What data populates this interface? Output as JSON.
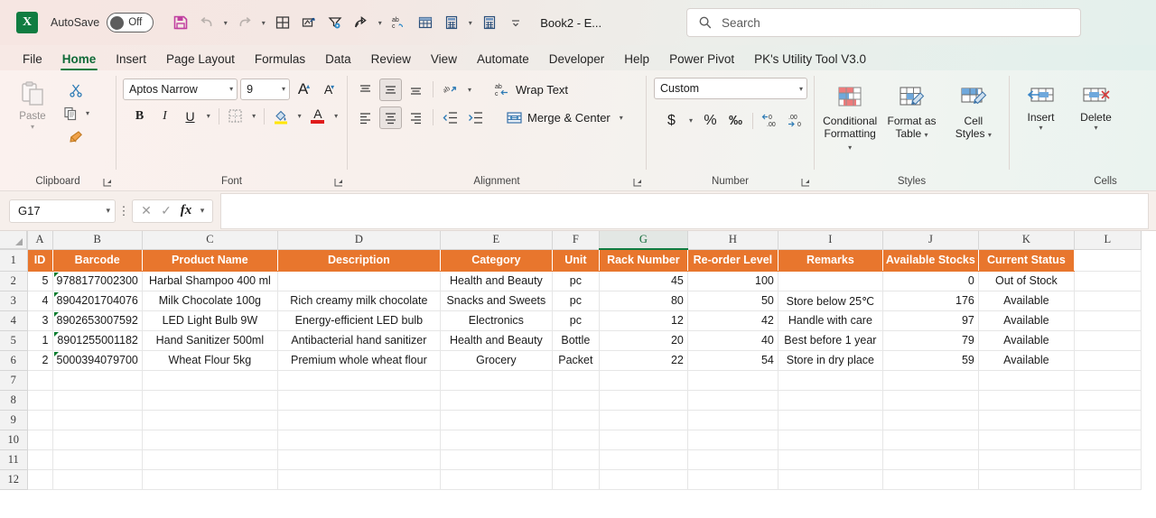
{
  "titlebar": {
    "app_icon": "excel-logo",
    "autosave_label": "AutoSave",
    "autosave_state": "Off",
    "workbook_name": "Book2  -  E...",
    "quick_access": [
      {
        "name": "save-icon",
        "glyph": "save"
      },
      {
        "name": "undo-icon",
        "glyph": "undo"
      },
      {
        "name": "redo-icon",
        "glyph": "redo"
      },
      {
        "name": "borders-icon",
        "glyph": "grid"
      },
      {
        "name": "camera-icon",
        "glyph": "camera"
      },
      {
        "name": "filter-settings-icon",
        "glyph": "funnel"
      },
      {
        "name": "share-icon",
        "glyph": "share"
      },
      {
        "name": "spelling-icon",
        "glyph": "abc"
      },
      {
        "name": "table-icon",
        "glyph": "table"
      },
      {
        "name": "calculate-icon",
        "glyph": "calc"
      },
      {
        "name": "calculate-sheet-icon",
        "glyph": "calc2"
      },
      {
        "name": "customize-toolbar-icon",
        "glyph": "chev"
      }
    ]
  },
  "search": {
    "placeholder": "Search",
    "icon": "search-icon"
  },
  "tabs": [
    {
      "label": "File",
      "active": false
    },
    {
      "label": "Home",
      "active": true
    },
    {
      "label": "Insert",
      "active": false
    },
    {
      "label": "Page Layout",
      "active": false
    },
    {
      "label": "Formulas",
      "active": false
    },
    {
      "label": "Data",
      "active": false
    },
    {
      "label": "Review",
      "active": false
    },
    {
      "label": "View",
      "active": false
    },
    {
      "label": "Automate",
      "active": false
    },
    {
      "label": "Developer",
      "active": false
    },
    {
      "label": "Help",
      "active": false
    },
    {
      "label": "Power Pivot",
      "active": false
    },
    {
      "label": "PK's Utility Tool V3.0",
      "active": false
    }
  ],
  "ribbon": {
    "clipboard": {
      "group_label": "Clipboard",
      "paste_label": "Paste",
      "cut_icon": "scissors-icon",
      "copy_icon": "copy-icon",
      "format_painter_icon": "format-painter-icon",
      "dialog_launcher": "dialog-launcher-icon"
    },
    "font": {
      "group_label": "Font",
      "font_family_value": "Aptos Narrow",
      "font_size_value": "9",
      "grow_font_label": "A",
      "shrink_font_label": "A",
      "bold_label": "B",
      "italic_label": "I",
      "underline_label": "U",
      "borders_icon": "borders-icon",
      "fill_color_icon": "fill-color-icon",
      "font_color_label": "A",
      "dialog_launcher": "dialog-launcher-icon"
    },
    "alignment": {
      "group_label": "Alignment",
      "wrap_text_label": "Wrap Text",
      "merge_center_label": "Merge & Center",
      "orientation_icon": "orientation-icon",
      "dialog_launcher": "dialog-launcher-icon"
    },
    "number": {
      "group_label": "Number",
      "format_value": "Custom",
      "currency_label": "$",
      "percent_label": "%",
      "comma_label": "‰",
      "increase_decimal_icon": "increase-decimal-icon",
      "decrease_decimal_icon": "decrease-decimal-icon",
      "dialog_launcher": "dialog-launcher-icon"
    },
    "styles": {
      "group_label": "Styles",
      "conditional_formatting_label": "Conditional\nFormatting",
      "conditional_formatting_line1": "Conditional",
      "conditional_formatting_line2": "Formatting",
      "format_as_table_line1": "Format as",
      "format_as_table_line2": "Table",
      "cell_styles_line1": "Cell",
      "cell_styles_line2": "Styles"
    },
    "cells": {
      "group_label": "Cells",
      "insert_label": "Insert",
      "delete_label": "Delete"
    }
  },
  "formula_bar": {
    "name_box_value": "G17",
    "cancel_icon": "cancel-icon",
    "enter_icon": "checkmark-icon",
    "function_icon": "fx-icon",
    "formula_value": ""
  },
  "grid": {
    "columns": [
      {
        "letter": "A",
        "width": 28,
        "selected": false
      },
      {
        "letter": "B",
        "width": 90,
        "selected": false
      },
      {
        "letter": "C",
        "width": 150,
        "selected": false
      },
      {
        "letter": "D",
        "width": 180,
        "selected": false
      },
      {
        "letter": "E",
        "width": 124,
        "selected": false
      },
      {
        "letter": "F",
        "width": 52,
        "selected": false
      },
      {
        "letter": "G",
        "width": 98,
        "selected": true
      },
      {
        "letter": "H",
        "width": 100,
        "selected": false
      },
      {
        "letter": "I",
        "width": 116,
        "selected": false
      },
      {
        "letter": "J",
        "width": 106,
        "selected": false
      },
      {
        "letter": "K",
        "width": 106,
        "selected": false
      },
      {
        "letter": "L",
        "width": 74,
        "selected": false
      }
    ],
    "row_numbers": [
      "1",
      "2",
      "3",
      "4",
      "5",
      "6",
      "7",
      "8",
      "9",
      "10",
      "11",
      "12"
    ],
    "header_row": {
      "row_number": "1",
      "cells": [
        "ID",
        "Barcode",
        "Product Name",
        "Description",
        "Category",
        "Unit",
        "Rack Number",
        "Re-order Level",
        "Remarks",
        "Available Stocks",
        "Current Status",
        ""
      ]
    },
    "data_rows": [
      {
        "row_number": "2",
        "id": "5",
        "barcode": "9788177002300",
        "product_name": "Harbal Shampoo 400 ml",
        "description": "",
        "category": "Health and Beauty",
        "unit": "pc",
        "rack_number": "45",
        "reorder_level": "100",
        "remarks": "",
        "available_stocks": "0",
        "current_status": "Out of Stock"
      },
      {
        "row_number": "3",
        "id": "4",
        "barcode": "8904201704076",
        "product_name": "Milk Chocolate 100g",
        "description": "Rich creamy milk chocolate",
        "category": "Snacks and Sweets",
        "unit": "pc",
        "rack_number": "80",
        "reorder_level": "50",
        "remarks": "Store below 25℃",
        "available_stocks": "176",
        "current_status": "Available"
      },
      {
        "row_number": "4",
        "id": "3",
        "barcode": "8902653007592",
        "product_name": "LED Light Bulb 9W",
        "description": "Energy-efficient LED bulb",
        "category": "Electronics",
        "unit": "pc",
        "rack_number": "12",
        "reorder_level": "42",
        "remarks": "Handle with care",
        "available_stocks": "97",
        "current_status": "Available"
      },
      {
        "row_number": "5",
        "id": "1",
        "barcode": "8901255001182",
        "product_name": "Hand Sanitizer 500ml",
        "description": "Antibacterial hand sanitizer",
        "category": "Health and Beauty",
        "unit": "Bottle",
        "rack_number": "20",
        "reorder_level": "40",
        "remarks": "Best before 1 year",
        "available_stocks": "79",
        "current_status": "Available"
      },
      {
        "row_number": "6",
        "id": "2",
        "barcode": "5000394079700",
        "product_name": "Wheat Flour 5kg",
        "description": "Premium whole wheat flour",
        "category": "Grocery",
        "unit": "Packet",
        "rack_number": "22",
        "reorder_level": "54",
        "remarks": "Store in dry place",
        "available_stocks": "59",
        "current_status": "Available"
      }
    ],
    "empty_rows": [
      "7",
      "8",
      "9",
      "10",
      "11",
      "12"
    ]
  },
  "colors": {
    "table_header_orange": "#e8762d",
    "excel_green": "#107c41",
    "selected_column_underline": "#107c41",
    "error_flag_green": "#0a7d2f"
  }
}
